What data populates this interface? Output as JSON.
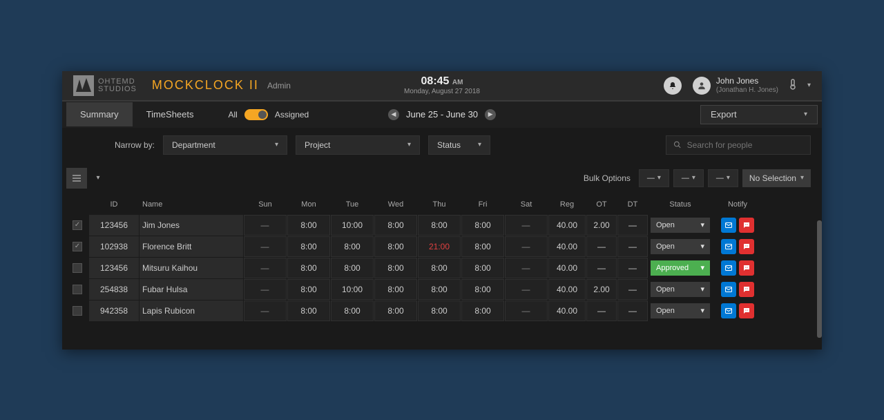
{
  "brand": {
    "line1": "OHTEMD",
    "line2": "STUDIOS"
  },
  "app_title": "MOCKCLOCK II",
  "role": "Admin",
  "clock": {
    "time": "08:45",
    "meridiem": "AM",
    "date": "Monday, August 27 2018"
  },
  "user": {
    "name": "John Jones",
    "legal": "(Jonathan H. Jones)"
  },
  "tabs": {
    "summary": "Summary",
    "timesheets": "TimeSheets"
  },
  "view_toggle": {
    "left": "All",
    "right": "Assigned"
  },
  "date_range": "June 25 - June 30",
  "export_label": "Export",
  "narrow_label": "Narrow by:",
  "filters": {
    "department": "Department",
    "project": "Project",
    "status": "Status"
  },
  "search_placeholder": "Search for people",
  "bulk_label": "Bulk Options",
  "no_selection": "No Selection",
  "columns": {
    "id": "ID",
    "name": "Name",
    "sun": "Sun",
    "mon": "Mon",
    "tue": "Tue",
    "wed": "Wed",
    "thu": "Thu",
    "fri": "Fri",
    "sat": "Sat",
    "reg": "Reg",
    "ot": "OT",
    "dt": "DT",
    "status": "Status",
    "notify": "Notify"
  },
  "blank_cell": "—",
  "rows": [
    {
      "checked": true,
      "id": "123456",
      "name": "Jim Jones",
      "sun": "—",
      "mon": "8:00",
      "tue": "10:00",
      "wed": "8:00",
      "thu": "8:00",
      "fri": "8:00",
      "sat": "—",
      "reg": "40.00",
      "ot": "2.00",
      "dt": "—",
      "status": "Open",
      "anomaly": null
    },
    {
      "checked": true,
      "id": "102938",
      "name": "Florence Britt",
      "sun": "—",
      "mon": "8:00",
      "tue": "8:00",
      "wed": "8:00",
      "thu": "21:00",
      "fri": "8:00",
      "sat": "—",
      "reg": "40.00",
      "ot": "—",
      "dt": "—",
      "status": "Open",
      "anomaly": "thu"
    },
    {
      "checked": false,
      "id": "123456",
      "name": "Mitsuru Kaihou",
      "sun": "—",
      "mon": "8:00",
      "tue": "8:00",
      "wed": "8:00",
      "thu": "8:00",
      "fri": "8:00",
      "sat": "—",
      "reg": "40.00",
      "ot": "—",
      "dt": "—",
      "status": "Approved",
      "anomaly": null
    },
    {
      "checked": false,
      "id": "254838",
      "name": "Fubar Hulsa",
      "sun": "—",
      "mon": "8:00",
      "tue": "10:00",
      "wed": "8:00",
      "thu": "8:00",
      "fri": "8:00",
      "sat": "—",
      "reg": "40.00",
      "ot": "2.00",
      "dt": "—",
      "status": "Open",
      "anomaly": null
    },
    {
      "checked": false,
      "id": "942358",
      "name": "Lapis Rubicon",
      "sun": "—",
      "mon": "8:00",
      "tue": "8:00",
      "wed": "8:00",
      "thu": "8:00",
      "fri": "8:00",
      "sat": "—",
      "reg": "40.00",
      "ot": "—",
      "dt": "—",
      "status": "Open",
      "anomaly": null
    }
  ]
}
